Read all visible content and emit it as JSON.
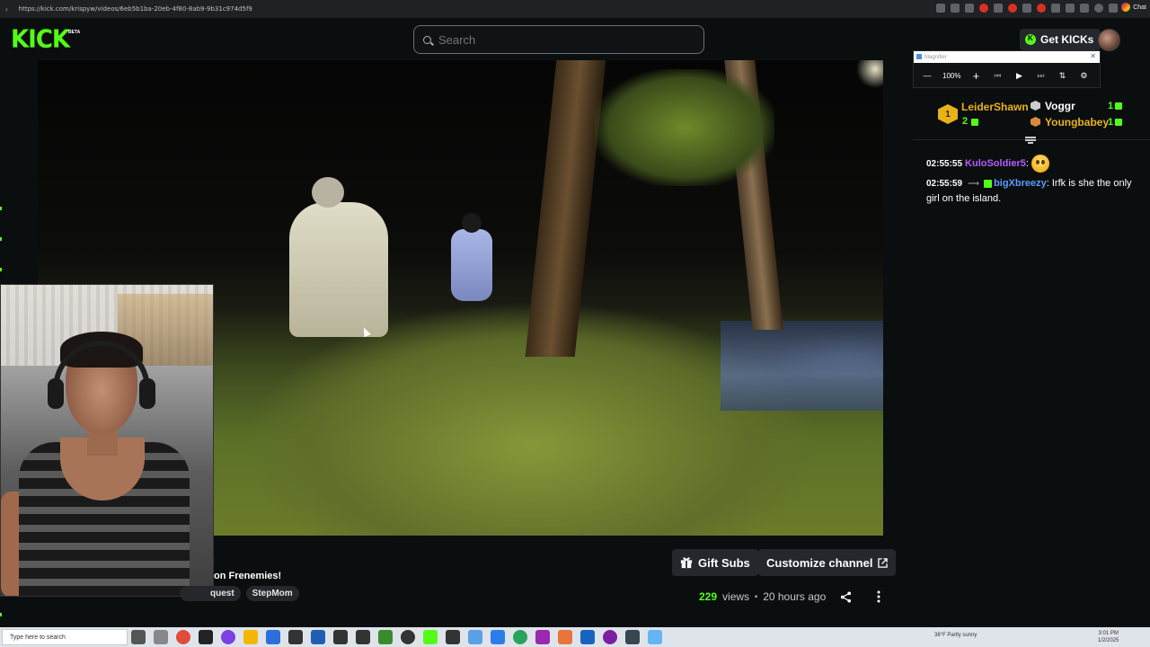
{
  "browser": {
    "url": "https://kick.com/krispyw/videos/6eb5b1ba-20eb-4f80-8ab9-9b31c974d5f9",
    "chat_label": "Chat"
  },
  "header": {
    "logo": "KICK",
    "logo_badge": "BETA",
    "search_placeholder": "Search",
    "get_kicks_label": "Get KICKs"
  },
  "player": {
    "progress_fraction": 0.72
  },
  "stream": {
    "title_visible": "on Frenemies!",
    "tags": [
      "quest",
      "StepMom"
    ],
    "gift_subs_label": "Gift Subs",
    "customize_label": "Customize channel",
    "views_count": "229",
    "views_label": "views",
    "separator": "•",
    "time_ago": "20 hours ago"
  },
  "magnifier": {
    "title": "Magnifier",
    "zoom": "100%"
  },
  "chat": {
    "leaderboard": {
      "first_rank": "1",
      "first_name": "LeiderShawn",
      "first_count": "2",
      "second_name": "Voggr",
      "second_count": "1",
      "third_name": "Youngbabey",
      "third_count": "1"
    },
    "messages": [
      {
        "time": "02:55:55",
        "user": "KuloSoldier5",
        "text": ""
      },
      {
        "time": "02:55:59",
        "user": "bigXbreezy",
        "text": "Irfk is she the only girl on the island."
      }
    ]
  },
  "taskbar": {
    "search_placeholder": "Type here to search",
    "weather": "38°F  Partly sunny",
    "time": "3:01 PM",
    "date": "1/2/2025"
  },
  "colors": {
    "kick_green": "#53fc18",
    "background": "#0b0e0f",
    "button_bg": "#24272c",
    "gold": "#e8b21a",
    "purple_user": "#b65cff",
    "blue_user": "#5b9cff"
  }
}
